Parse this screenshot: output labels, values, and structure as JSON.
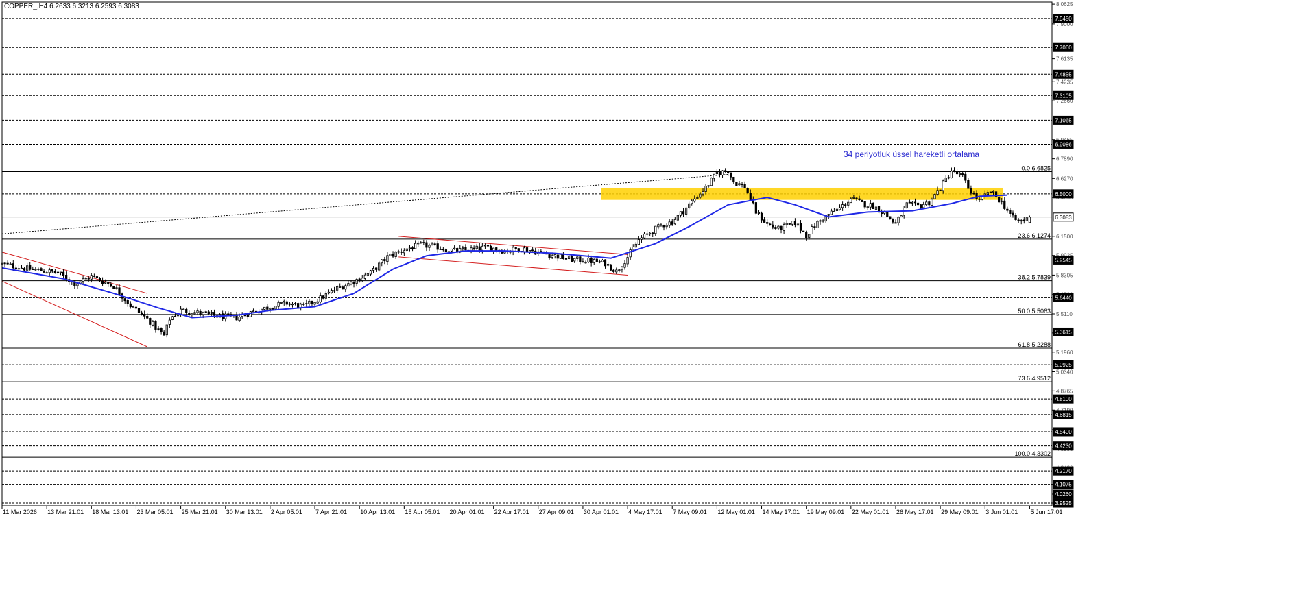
{
  "header": {
    "symbol_text": "COPPER_,H4  6.2633 6.3213 6.2593 6.3083"
  },
  "annotation": {
    "ema_label": "34 periyotluk üssel hareketli ortalama"
  },
  "colors": {
    "background": "#ffffff",
    "candle": "#000000",
    "ema": "#1f28e6",
    "channel": "#d42020",
    "zone": "#ffd000",
    "annotation": "#2b2bd0",
    "grid": "#000000"
  },
  "chart_data": {
    "type": "candlestick",
    "symbol": "COPPER_",
    "timeframe": "H4",
    "ohlc_current": {
      "open": 6.2633,
      "high": 6.3213,
      "low": 6.2593,
      "close": 6.3083
    },
    "ylim": [
      3.93,
      8.08
    ],
    "y_axis_ticks": [
      "8.0625",
      "7.9000",
      "7.6135",
      "7.4235",
      "7.2660",
      "6.9465",
      "6.7890",
      "6.6270",
      "6.4695",
      "6.1500",
      "5.9925",
      "5.8305",
      "5.6730",
      "5.5110",
      "5.3535",
      "5.1960",
      "5.0340",
      "4.8765",
      "4.7190",
      "4.5570",
      "4.3995",
      "4.2420",
      "4.1075",
      "4.0260",
      "3.9525"
    ],
    "price_levels": [
      "7.9450",
      "7.7060",
      "7.4855",
      "7.3105",
      "7.1065",
      "6.9086",
      "6.5000",
      "6.3083",
      "5.9545",
      "5.6440",
      "5.3615",
      "5.0925",
      "4.8100",
      "4.6815",
      "4.5400",
      "4.4230",
      "4.2170",
      "4.1075",
      "4.0260",
      "3.9525"
    ],
    "horizontal_dashed_lines": [
      7.945,
      7.706,
      7.4855,
      7.3105,
      7.1065,
      6.9086,
      6.5,
      5.9545,
      5.644,
      5.3615,
      5.0925,
      4.81,
      4.6815,
      4.54,
      4.423,
      4.217,
      4.1075,
      3.9525
    ],
    "fibonacci": [
      {
        "label": "0.0 6.6825",
        "value": 6.6825
      },
      {
        "label": "23.6 6.1274",
        "value": 6.1274
      },
      {
        "label": "38.2 5.7839",
        "value": 5.7839
      },
      {
        "label": "50.0 5.5063",
        "value": 5.5063
      },
      {
        "label": "61.8 5.2288",
        "value": 5.2288
      },
      {
        "label": "73.6 4.9512",
        "value": 4.9512
      },
      {
        "label": "100.0 4.3302",
        "value": 4.3302
      }
    ],
    "resistance_zone": {
      "from": 6.45,
      "to": 6.55
    },
    "x_labels": [
      "11 Mar 2026",
      "13 Mar 21:01",
      "18 Mar 13:01",
      "23 Mar 05:01",
      "25 Mar 21:01",
      "30 Mar 13:01",
      "2 Apr 05:01",
      "7 Apr 21:01",
      "10 Apr 13:01",
      "15 Apr 05:01",
      "20 Apr 01:01",
      "22 Apr 17:01",
      "27 Apr 09:01",
      "30 Apr 01:01",
      "4 May 17:01",
      "7 May 09:01",
      "12 May 01:01",
      "14 May 17:01",
      "19 May 09:01",
      "22 May 01:01",
      "26 May 17:01",
      "29 May 09:01",
      "3 Jun 01:01",
      "5 Jun 17:01"
    ],
    "price_path": [
      [
        0,
        5.92
      ],
      [
        10,
        5.88
      ],
      [
        20,
        5.85
      ],
      [
        26,
        5.76
      ],
      [
        32,
        5.82
      ],
      [
        40,
        5.74
      ],
      [
        46,
        5.58
      ],
      [
        52,
        5.47
      ],
      [
        58,
        5.33
      ],
      [
        60,
        5.47
      ],
      [
        64,
        5.54
      ],
      [
        70,
        5.52
      ],
      [
        78,
        5.49
      ],
      [
        84,
        5.48
      ],
      [
        90,
        5.53
      ],
      [
        96,
        5.57
      ],
      [
        102,
        5.6
      ],
      [
        108,
        5.57
      ],
      [
        114,
        5.64
      ],
      [
        120,
        5.72
      ],
      [
        126,
        5.78
      ],
      [
        132,
        5.85
      ],
      [
        138,
        5.98
      ],
      [
        144,
        6.04
      ],
      [
        150,
        6.08
      ],
      [
        156,
        6.06
      ],
      [
        162,
        6.03
      ],
      [
        168,
        6.04
      ],
      [
        174,
        6.06
      ],
      [
        180,
        6.03
      ],
      [
        186,
        6.05
      ],
      [
        192,
        6.02
      ],
      [
        198,
        5.99
      ],
      [
        204,
        5.96
      ],
      [
        210,
        5.95
      ],
      [
        216,
        5.93
      ],
      [
        220,
        5.86
      ],
      [
        224,
        5.98
      ],
      [
        228,
        6.12
      ],
      [
        232,
        6.18
      ],
      [
        236,
        6.24
      ],
      [
        240,
        6.27
      ],
      [
        244,
        6.36
      ],
      [
        248,
        6.46
      ],
      [
        252,
        6.55
      ],
      [
        256,
        6.67
      ],
      [
        260,
        6.69
      ],
      [
        262,
        6.6
      ],
      [
        266,
        6.56
      ],
      [
        270,
        6.35
      ],
      [
        274,
        6.25
      ],
      [
        278,
        6.21
      ],
      [
        284,
        6.26
      ],
      [
        288,
        6.16
      ],
      [
        292,
        6.26
      ],
      [
        296,
        6.33
      ],
      [
        300,
        6.38
      ],
      [
        304,
        6.46
      ],
      [
        308,
        6.42
      ],
      [
        312,
        6.4
      ],
      [
        316,
        6.34
      ],
      [
        320,
        6.25
      ],
      [
        324,
        6.41
      ],
      [
        328,
        6.4
      ],
      [
        332,
        6.43
      ],
      [
        336,
        6.55
      ],
      [
        340,
        6.69
      ],
      [
        344,
        6.64
      ],
      [
        346,
        6.55
      ],
      [
        350,
        6.44
      ],
      [
        354,
        6.52
      ],
      [
        358,
        6.43
      ],
      [
        362,
        6.3
      ],
      [
        364,
        6.27
      ],
      [
        368,
        6.3
      ]
    ],
    "ema_period": 34,
    "series": [
      {
        "name": "34 periyotluk üssel hareketli ortalama",
        "type": "line",
        "points": [
          [
            0,
            5.89
          ],
          [
            22,
            5.8
          ],
          [
            40,
            5.68
          ],
          [
            56,
            5.56
          ],
          [
            68,
            5.48
          ],
          [
            84,
            5.5
          ],
          [
            96,
            5.54
          ],
          [
            112,
            5.57
          ],
          [
            126,
            5.68
          ],
          [
            140,
            5.88
          ],
          [
            152,
            5.99
          ],
          [
            166,
            6.03
          ],
          [
            180,
            6.03
          ],
          [
            198,
            6.01
          ],
          [
            218,
            5.97
          ],
          [
            234,
            6.09
          ],
          [
            246,
            6.23
          ],
          [
            260,
            6.41
          ],
          [
            274,
            6.47
          ],
          [
            284,
            6.41
          ],
          [
            296,
            6.31
          ],
          [
            310,
            6.35
          ],
          [
            326,
            6.36
          ],
          [
            340,
            6.42
          ],
          [
            350,
            6.48
          ],
          [
            360,
            6.49
          ]
        ]
      }
    ],
    "channels": [
      {
        "name": "",
        "upper": [
          [
            0,
            6.02
          ],
          [
            52,
            5.68
          ]
        ],
        "lower": [
          [
            0,
            5.78
          ],
          [
            52,
            5.24
          ]
        ]
      },
      {
        "name": "",
        "upper": [
          [
            142,
            6.15
          ],
          [
            224,
            6.0
          ]
        ],
        "lower": [
          [
            142,
            5.98
          ],
          [
            224,
            5.83
          ]
        ]
      }
    ],
    "dotted_trendline": [
      [
        0,
        6.17
      ],
      [
        260,
        6.66
      ]
    ],
    "x_domain": [
      0,
      376
    ]
  }
}
